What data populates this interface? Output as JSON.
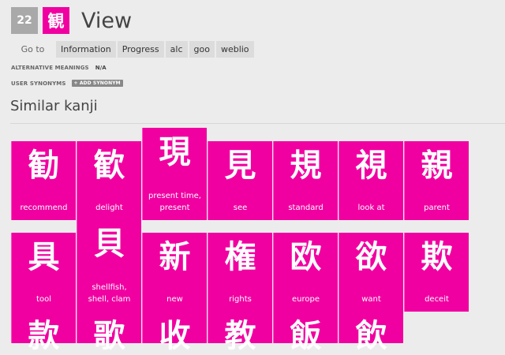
{
  "header": {
    "level": "22",
    "kanji": "観",
    "title": "View"
  },
  "tabs": [
    {
      "label": "Go to"
    },
    {
      "label": "Information"
    },
    {
      "label": "Progress"
    },
    {
      "label": "alc"
    },
    {
      "label": "goo"
    },
    {
      "label": "weblio"
    }
  ],
  "meta": {
    "alt_meanings_label": "ALTERNATIVE MEANINGS",
    "alt_meanings_value": "N/A",
    "synonyms_label": "USER SYNONYMS",
    "add_synonym": "+ ADD SYNONYM"
  },
  "section": {
    "title": "Similar kanji"
  },
  "similar": [
    {
      "kanji": "勧",
      "meaning": "recommend"
    },
    {
      "kanji": "歓",
      "meaning": "delight"
    },
    {
      "kanji": "現",
      "meaning": "present time, present"
    },
    {
      "kanji": "見",
      "meaning": "see"
    },
    {
      "kanji": "規",
      "meaning": "standard"
    },
    {
      "kanji": "視",
      "meaning": "look at"
    },
    {
      "kanji": "親",
      "meaning": "parent"
    },
    {
      "kanji": "具",
      "meaning": "tool"
    },
    {
      "kanji": "貝",
      "meaning": "shellfish, shell, clam"
    },
    {
      "kanji": "新",
      "meaning": "new"
    },
    {
      "kanji": "権",
      "meaning": "rights"
    },
    {
      "kanji": "欧",
      "meaning": "europe"
    },
    {
      "kanji": "欲",
      "meaning": "want"
    },
    {
      "kanji": "欺",
      "meaning": "deceit"
    },
    {
      "kanji": "款",
      "meaning": ""
    },
    {
      "kanji": "歌",
      "meaning": ""
    },
    {
      "kanji": "收",
      "meaning": ""
    },
    {
      "kanji": "教",
      "meaning": ""
    },
    {
      "kanji": "飯",
      "meaning": ""
    },
    {
      "kanji": "飲",
      "meaning": ""
    }
  ],
  "colors": {
    "accent": "#f100a1",
    "badge_gray": "#a9a9a9",
    "background": "#ececec"
  }
}
